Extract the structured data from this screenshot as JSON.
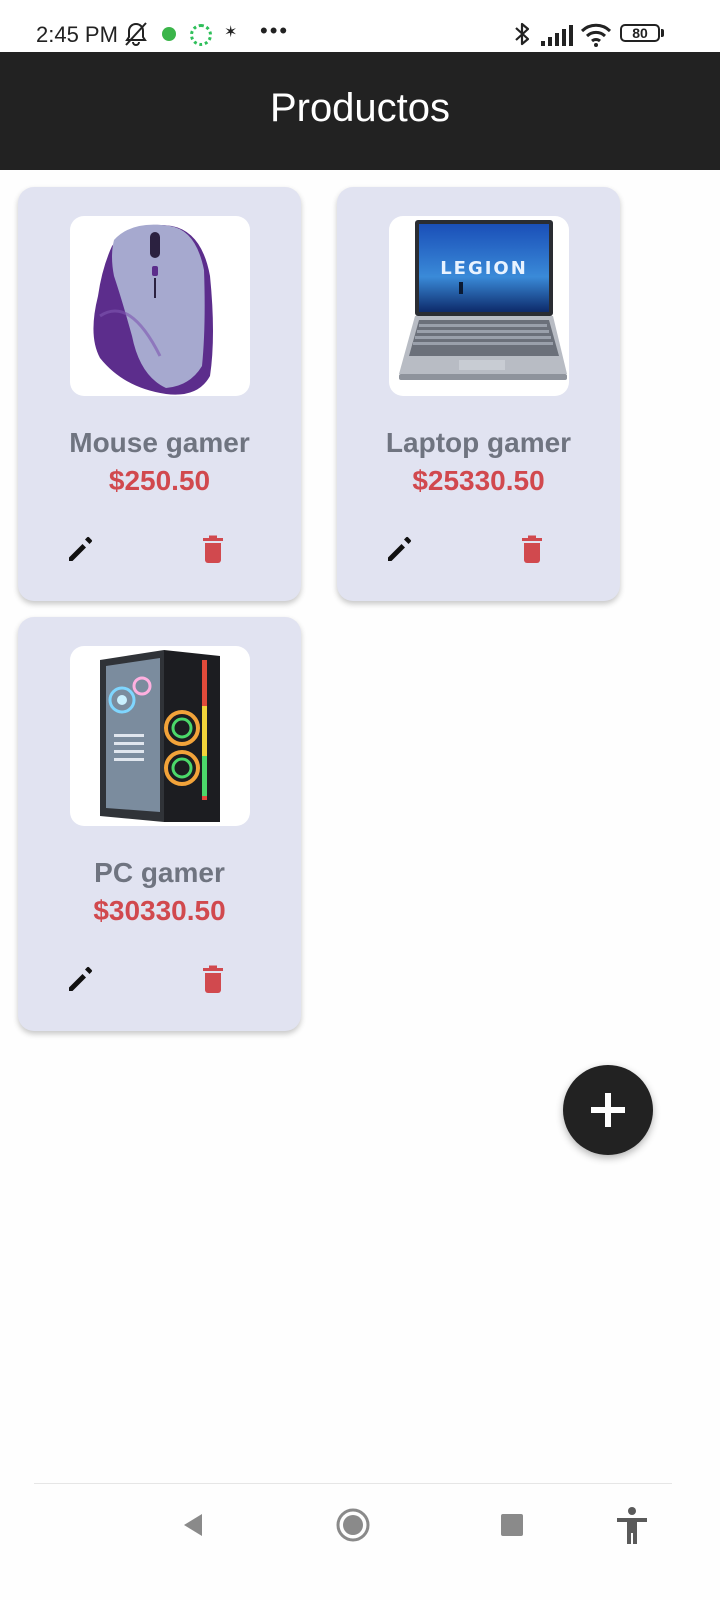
{
  "status_bar": {
    "time": "2:45 PM",
    "more": "•••",
    "battery": "80",
    "icons": [
      "bell-off-icon",
      "green-app-icon",
      "sync-ring-icon",
      "small-notification-icon",
      "bluetooth-icon",
      "signal-icon",
      "wifi-icon",
      "battery-icon"
    ]
  },
  "app_bar": {
    "title": "Productos"
  },
  "products": [
    {
      "name": "Mouse gamer",
      "price": "$250.50",
      "image": "gaming-mouse"
    },
    {
      "name": "Laptop gamer",
      "price": "$25330.50",
      "image": "gaming-laptop",
      "image_text": "LEGION"
    },
    {
      "name": "PC gamer",
      "price": "$30330.50",
      "image": "gaming-pc"
    }
  ],
  "actions": {
    "edit_icon": "pencil-icon",
    "delete_icon": "trash-icon",
    "add_icon": "plus-icon"
  },
  "colors": {
    "app_bar": "#222222",
    "card_background": "#e1e3f1",
    "product_name": "#6f7480",
    "price": "#d1494e",
    "delete_icon": "#d1494e",
    "fab": "#222222"
  },
  "nav_bar": {
    "icons": [
      "back-icon",
      "home-icon",
      "recents-icon",
      "accessibility-icon"
    ]
  }
}
